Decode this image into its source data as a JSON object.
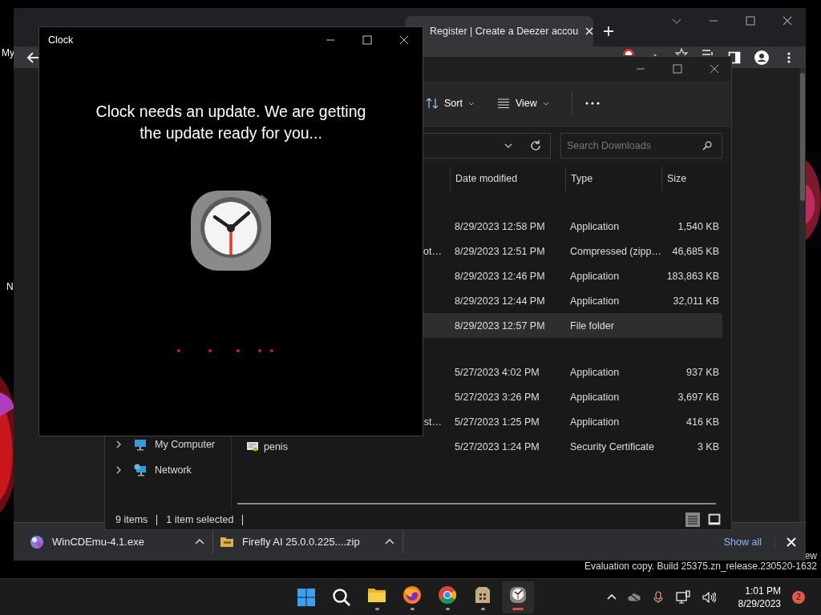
{
  "desktop": {
    "icon_labels": [
      "My",
      "N"
    ],
    "watermark": [
      "ew",
      "Evaluation copy. Build 25375.zn_release.230520-1632"
    ]
  },
  "browser": {
    "active_tab": {
      "title": "Register | Create a Deezer accou"
    },
    "downloads": [
      {
        "name": "WinCDEmu-4.1.exe",
        "kind": "app"
      },
      {
        "name": "Firefly AI 25.0.0.225....zip",
        "kind": "zip"
      }
    ],
    "show_all": "Show all"
  },
  "explorer": {
    "toolbar": [
      {
        "label": "Sort",
        "kind": "sort"
      },
      {
        "label": "View",
        "kind": "view"
      }
    ],
    "search": {
      "placeholder": "Search Downloads"
    },
    "columns": [
      "Date modified",
      "Type",
      "Size"
    ],
    "groups": [
      {
        "rows": [
          {
            "name": "",
            "date": "8/29/2023 12:58 PM",
            "type": "Application",
            "size": "1,540 KB",
            "selected": false
          },
          {
            "name": "ot…",
            "date": "8/29/2023 12:51 PM",
            "type": "Compressed (zipp…",
            "size": "46,685 KB",
            "selected": false
          },
          {
            "name": "",
            "date": "8/29/2023 12:46 PM",
            "type": "Application",
            "size": "183,863 KB",
            "selected": false
          },
          {
            "name": "",
            "date": "8/29/2023 12:44 PM",
            "type": "Application",
            "size": "32,011 KB",
            "selected": false
          },
          {
            "name": "",
            "date": "8/29/2023 12:57 PM",
            "type": "File folder",
            "size": "",
            "selected": true
          }
        ]
      },
      {
        "rows": [
          {
            "name": "",
            "date": "5/27/2023 4:02 PM",
            "type": "Application",
            "size": "937 KB",
            "selected": false
          },
          {
            "name": "",
            "date": "5/27/2023 3:26 PM",
            "type": "Application",
            "size": "3,697 KB",
            "selected": false
          },
          {
            "name": "st…",
            "date": "5/27/2023 1:25 PM",
            "type": "Application",
            "size": "416 KB",
            "selected": false
          },
          {
            "name": "penis",
            "kind": "certificate",
            "date": "5/27/2023 1:24 PM",
            "type": "Security Certificate",
            "size": "3 KB",
            "selected": false
          }
        ]
      }
    ],
    "nav": [
      {
        "label": "My Computer",
        "kind": "computer"
      },
      {
        "label": "Network",
        "kind": "network"
      }
    ],
    "status": {
      "count": "9 items",
      "selection": "1 item selected"
    }
  },
  "clock_window": {
    "title": "Clock",
    "message": "Clock needs an update. We are getting the update ready for you..."
  },
  "taskbar": {
    "apps": [
      {
        "kind": "explorer",
        "running": true,
        "selected": false
      },
      {
        "kind": "firefox",
        "running": true,
        "selected": false
      },
      {
        "kind": "chrome",
        "running": true,
        "selected": false
      },
      {
        "kind": "package",
        "running": true,
        "selected": false
      },
      {
        "kind": "clock",
        "running": true,
        "selected": true
      }
    ],
    "time": "1:01 PM",
    "date": "8/29/2023",
    "notifications": "2"
  }
}
